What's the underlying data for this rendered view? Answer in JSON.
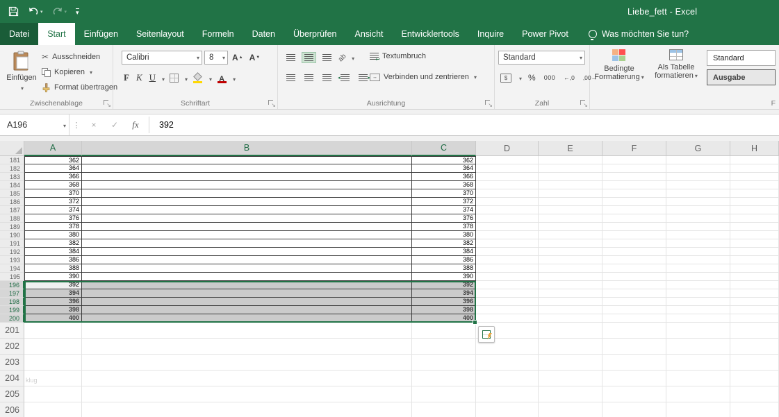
{
  "title_bar": {
    "title": "Liebe_fett  -  Excel"
  },
  "ribbon": {
    "tabs": [
      {
        "label": "Datei",
        "active": false
      },
      {
        "label": "Start",
        "active": true
      },
      {
        "label": "Einfügen",
        "active": false
      },
      {
        "label": "Seitenlayout",
        "active": false
      },
      {
        "label": "Formeln",
        "active": false
      },
      {
        "label": "Daten",
        "active": false
      },
      {
        "label": "Überprüfen",
        "active": false
      },
      {
        "label": "Ansicht",
        "active": false
      },
      {
        "label": "Entwicklertools",
        "active": false
      },
      {
        "label": "Inquire",
        "active": false
      },
      {
        "label": "Power Pivot",
        "active": false
      }
    ],
    "tell_me": "Was möchten Sie tun?",
    "clipboard": {
      "group_label": "Zwischenablage",
      "paste": "Einfügen",
      "cut": "Ausschneiden",
      "copy": "Kopieren",
      "format_painter": "Format übertragen"
    },
    "font_group": {
      "group_label": "Schriftart",
      "font_name": "Calibri",
      "font_size": "8",
      "bold": "F",
      "italic": "K",
      "underline": "U"
    },
    "alignment_group": {
      "group_label": "Ausrichtung",
      "wrap_text": "Textumbruch",
      "merge_center": "Verbinden und zentrieren"
    },
    "number_group": {
      "group_label": "Zahl",
      "format_selected": "Standard",
      "percent": "%",
      "thousands": "000",
      "increase_decimal": "←,0",
      "decrease_decimal": ",00→"
    },
    "styles_group": {
      "group_label_visible": "F",
      "conditional_formatting": "Bedingte Formatierung",
      "format_as_table": "Als Tabelle formatieren",
      "cell_styles_gallery": [
        {
          "label": "Standard",
          "selected": false
        },
        {
          "label": "Ausgabe",
          "selected": true
        }
      ]
    }
  },
  "formula_bar": {
    "name_box": "A196",
    "cancel": "×",
    "enter": "✓",
    "fx": "fx",
    "content": "392"
  },
  "grid": {
    "column_headers": [
      "A",
      "B",
      "C",
      "D",
      "E",
      "F",
      "G",
      "H"
    ],
    "selected_columns": [
      "A",
      "B",
      "C"
    ],
    "selection": {
      "active_cell": "A196",
      "selected_rows_from": 196,
      "selected_rows_to": 200
    },
    "data_block": {
      "rows": [
        {
          "row": 181,
          "A": "362",
          "B": "",
          "C": "362"
        },
        {
          "row": 182,
          "A": "364",
          "B": "",
          "C": "364"
        },
        {
          "row": 183,
          "A": "366",
          "B": "",
          "C": "366"
        },
        {
          "row": 184,
          "A": "368",
          "B": "",
          "C": "368"
        },
        {
          "row": 185,
          "A": "370",
          "B": "",
          "C": "370"
        },
        {
          "row": 186,
          "A": "372",
          "B": "",
          "C": "372"
        },
        {
          "row": 187,
          "A": "374",
          "B": "",
          "C": "374"
        },
        {
          "row": 188,
          "A": "376",
          "B": "",
          "C": "376"
        },
        {
          "row": 189,
          "A": "378",
          "B": "",
          "C": "378"
        },
        {
          "row": 190,
          "A": "380",
          "B": "",
          "C": "380"
        },
        {
          "row": 191,
          "A": "382",
          "B": "",
          "C": "382"
        },
        {
          "row": 192,
          "A": "384",
          "B": "",
          "C": "384"
        },
        {
          "row": 193,
          "A": "386",
          "B": "",
          "C": "386"
        },
        {
          "row": 194,
          "A": "388",
          "B": "",
          "C": "388"
        },
        {
          "row": 195,
          "A": "390",
          "B": "",
          "C": "390"
        },
        {
          "row": 196,
          "A": "392",
          "B": "",
          "C": "392"
        },
        {
          "row": 197,
          "A": "394",
          "B": "",
          "C": "394"
        },
        {
          "row": 198,
          "A": "396",
          "B": "",
          "C": "396"
        },
        {
          "row": 199,
          "A": "398",
          "B": "",
          "C": "398"
        },
        {
          "row": 200,
          "A": "400",
          "B": "",
          "C": "400"
        }
      ]
    },
    "empty_rows": [
      201,
      202,
      203,
      204,
      205,
      206
    ],
    "faint_cell_text": {
      "row": 204,
      "col": "A",
      "text": "klug"
    }
  }
}
